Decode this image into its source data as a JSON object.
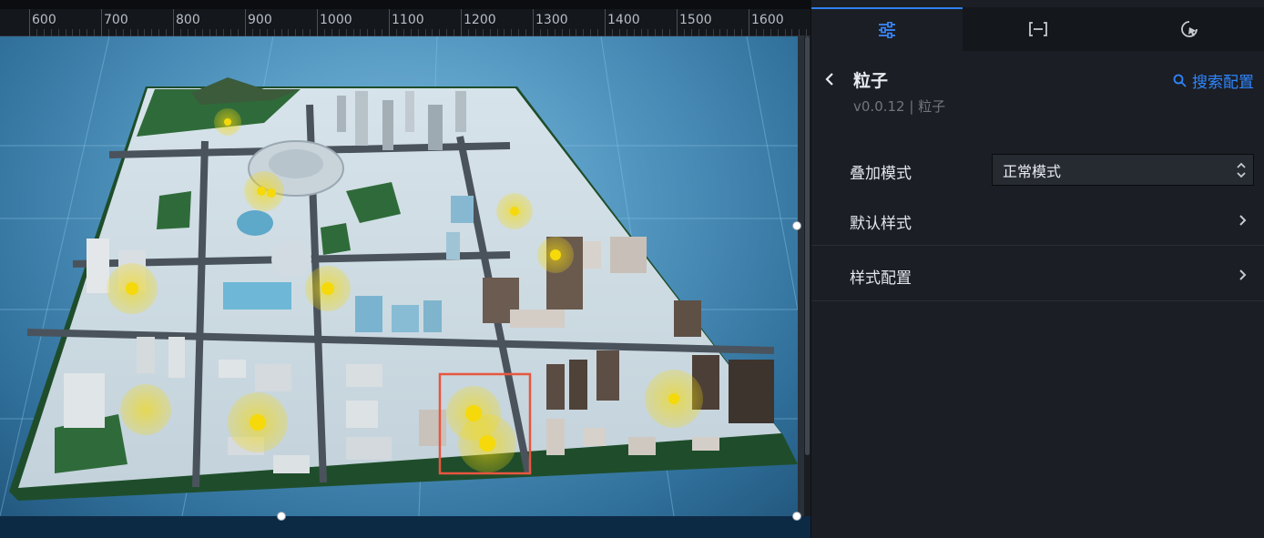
{
  "ruler": {
    "labels": [
      "600",
      "700",
      "800",
      "900",
      "1000",
      "1100",
      "1200",
      "1300",
      "1400",
      "1500",
      "1600"
    ]
  },
  "panel": {
    "tabs": [
      {
        "icon": "sliders-icon",
        "active": true
      },
      {
        "icon": "bracket-icon",
        "active": false
      },
      {
        "icon": "interaction-icon",
        "active": false
      }
    ],
    "title": "粒子",
    "version": "v0.0.12 | 粒子",
    "search_label": "搜索配置",
    "blend_mode": {
      "label": "叠加模式",
      "value": "正常模式"
    },
    "default_style": {
      "label": "默认样式"
    },
    "style_config": {
      "label": "样式配置"
    }
  },
  "colors": {
    "accent": "#2f7ff0",
    "link": "#2f86ff",
    "particle": "#f5d90a",
    "selection": "#e8553f"
  }
}
